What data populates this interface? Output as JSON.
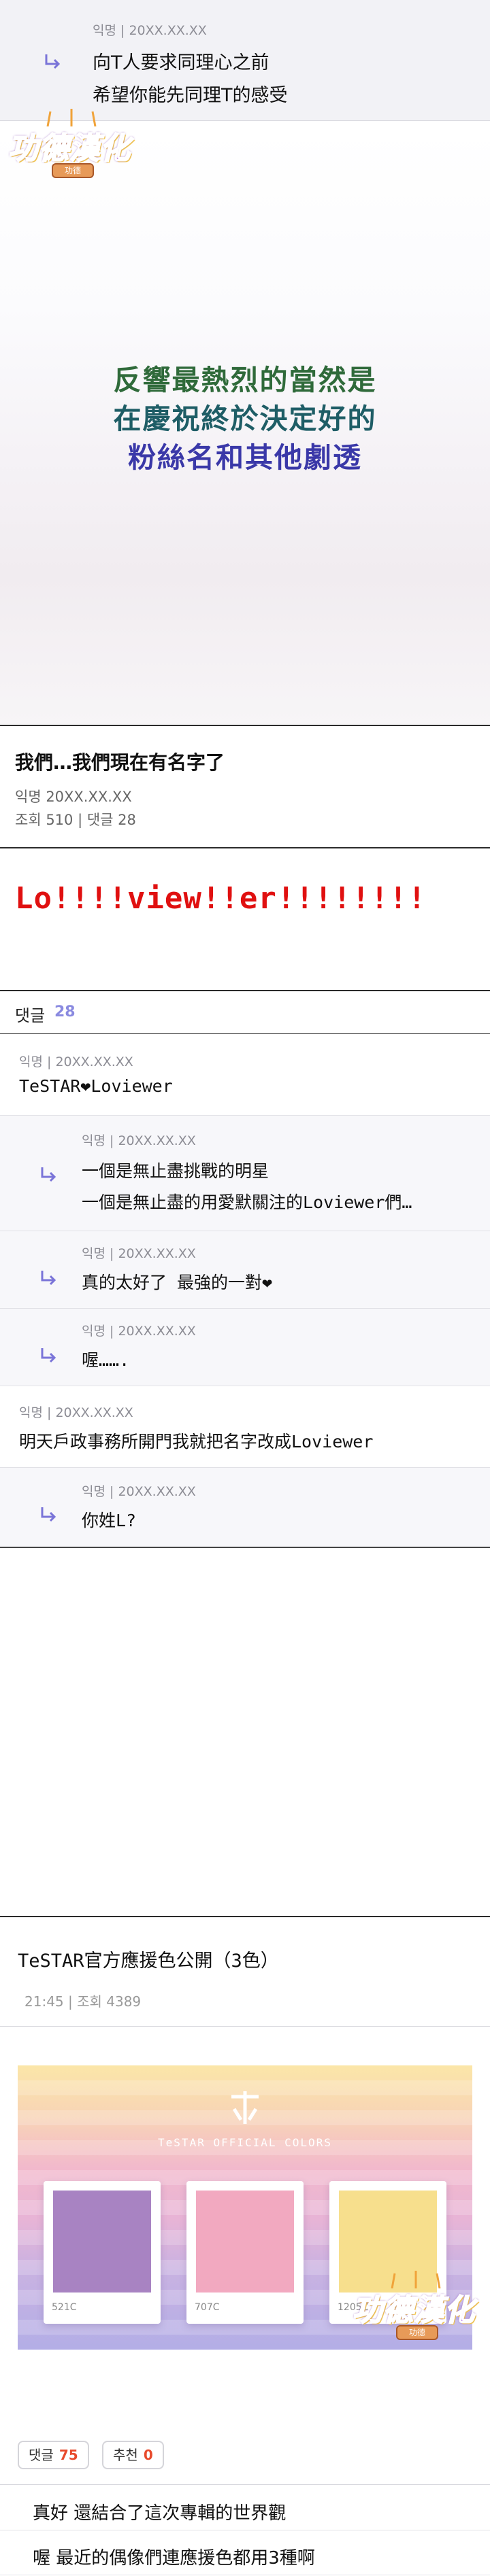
{
  "top_reply": {
    "meta": "익명 | 20XX.XX.XX",
    "line1": "向T人要求同理心之前",
    "line2": "希望你能先同理T的感受"
  },
  "logo": {
    "text": "功德漢化",
    "badge": "功德"
  },
  "hero": {
    "lines": [
      "反響最熱烈的當然是",
      "在慶祝終於決定好的",
      "粉絲名和其他劇透"
    ],
    "colors": [
      "#2f6a3a",
      "#1e5d66",
      "#3a38a8"
    ]
  },
  "post": {
    "title": "我們…我們現在有名字了",
    "author_date": "익명 20XX.XX.XX",
    "stats": "조회 510 | 댓글 28",
    "headline": "Lo!!!!view!!er!!!!!!!!"
  },
  "comments_header": {
    "label": "댓글",
    "count": "28"
  },
  "comments": [
    {
      "type": "root",
      "meta": "익명 | 20XX.XX.XX",
      "lines": [
        "TeSTAR❤Loviewer"
      ]
    },
    {
      "type": "reply",
      "meta": "익명 | 20XX.XX.XX",
      "lines": [
        "一個是無止盡挑戰的明星",
        "一個是無止盡的用愛默關注的Loviewer們…"
      ]
    },
    {
      "type": "reply",
      "meta": "익명 | 20XX.XX.XX",
      "lines": [
        "真的太好了 最強的一對❤"
      ]
    },
    {
      "type": "reply",
      "meta": "익명 | 20XX.XX.XX",
      "lines": [
        "喔……."
      ]
    },
    {
      "type": "root",
      "meta": "익명 | 20XX.XX.XX",
      "lines": [
        "明天戶政事務所開門我就把名字改成Loviewer"
      ]
    },
    {
      "type": "reply",
      "meta": "익명 | 20XX.XX.XX",
      "lines": [
        "你姓L?"
      ]
    }
  ],
  "article": {
    "title": "TeSTAR官方應援色公開（3色）",
    "meta": "21:45 | 조회 4389",
    "image_caption": "TeSTAR OFFICIAL COLORS",
    "swatches": [
      {
        "code": "521C",
        "color": "#a883c2"
      },
      {
        "code": "707C",
        "color": "#f2a9c0"
      },
      {
        "code": "1205C",
        "color": "#f7df8d"
      }
    ],
    "comments_chip": {
      "label": "댓글",
      "count": "75"
    },
    "recommend_chip": {
      "label": "추천",
      "count": "0"
    },
    "replies": [
      "真好  還結合了這次專輯的世界觀",
      "喔  最近的偶像們連應援色都用3種啊"
    ]
  }
}
